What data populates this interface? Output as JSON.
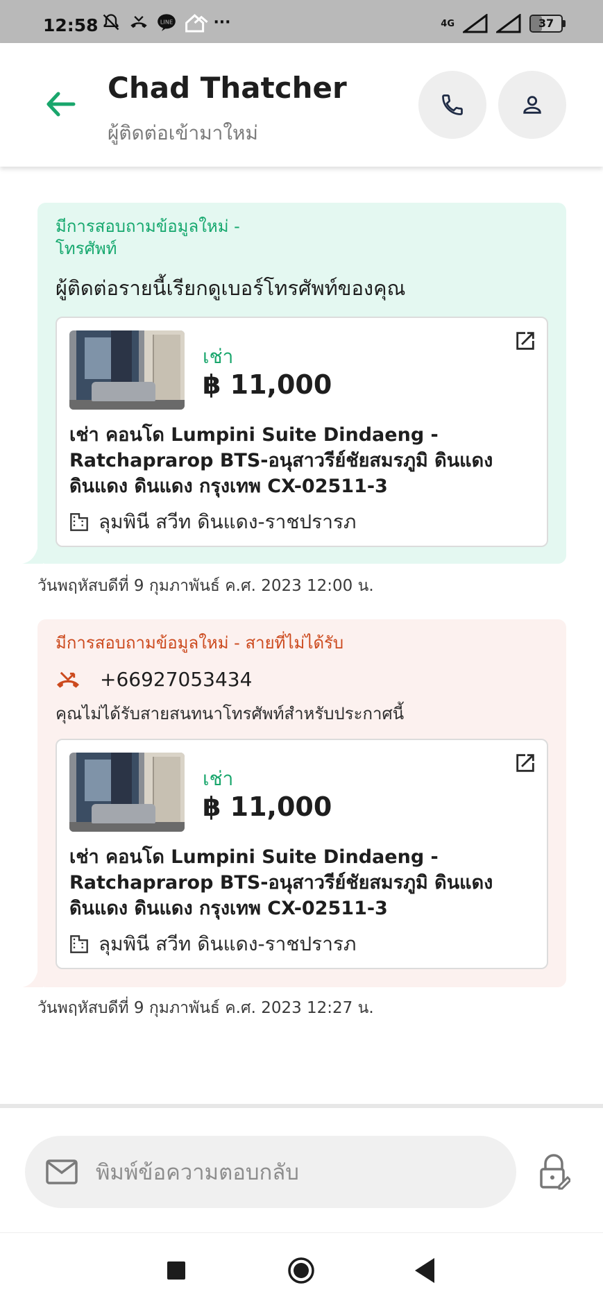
{
  "status_bar": {
    "time": "12:58",
    "network": "4G",
    "battery": "37",
    "more": "···"
  },
  "header": {
    "title": "Chad Thatcher",
    "subtitle": "ผู้ติดต่อเข้ามาใหม่"
  },
  "messages": [
    {
      "type": "phone_inquiry",
      "heading": "มีการสอบถามข้อมูลใหม่ -\nโทรศัพท์",
      "description": "ผู้ติดต่อรายนี้เรียกดูเบอร์โทรศัพท์ของคุณ",
      "listing": {
        "rent_label": "เช่า",
        "price": "฿ 11,000",
        "title": "เช่า คอนโด  Lumpini Suite Dindaeng - Ratchaprarop BTS-อนุสาวรีย์ชัยสมรภูมิ ดินแดง ดินแดง ดินแดง กรุงเทพ CX-02511-3",
        "project": "ลุมพินี สวีท ดินแดง-ราชปรารภ"
      },
      "timestamp": "วันพฤหัสบดีที่ 9 กุมภาพันธ์ ค.ศ. 2023 12:00 น."
    },
    {
      "type": "missed_call",
      "heading": "มีการสอบถามข้อมูลใหม่ - สายที่ไม่ได้รับ",
      "phone": "+66927053434",
      "description": "คุณไม่ได้รับสายสนทนาโทรศัพท์สำหรับประกาศนี้",
      "listing": {
        "rent_label": "เช่า",
        "price": "฿ 11,000",
        "title": "เช่า คอนโด  Lumpini Suite Dindaeng - Ratchaprarop BTS-อนุสาวรีย์ชัยสมรภูมิ ดินแดง ดินแดง ดินแดง กรุงเทพ CX-02511-3",
        "project": "ลุมพินี สวีท ดินแดง-ราชปรารภ"
      },
      "timestamp": "วันพฤหัสบดีที่ 9 กุมภาพันธ์ ค.ศ. 2023 12:27 น."
    }
  ],
  "reply": {
    "placeholder": "พิมพ์ข้อความตอบกลับ"
  },
  "icons": {
    "back": "arrow-left-icon",
    "call": "phone-icon",
    "profile": "person-icon",
    "external": "open-external-icon",
    "building": "building-icon",
    "missed_call": "missed-call-icon",
    "mail": "mail-icon",
    "lock": "lock-edit-icon"
  },
  "colors": {
    "accent_green": "#16a86e",
    "accent_red": "#cc4a1e",
    "card_green": "#e4f8f1",
    "card_peach": "#fcf1ef"
  }
}
